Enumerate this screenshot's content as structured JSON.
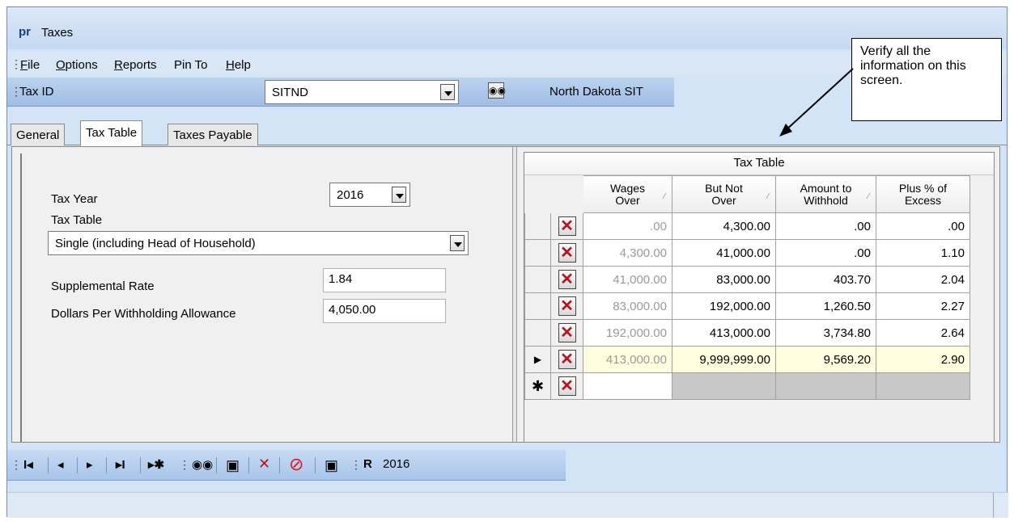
{
  "window": {
    "app_logo": "pr",
    "title": "Taxes"
  },
  "menu": [
    {
      "label": "File",
      "u": "F"
    },
    {
      "label": "Options",
      "u": "O"
    },
    {
      "label": "Reports",
      "u": "R"
    },
    {
      "label": "Pin To",
      "u": ""
    },
    {
      "label": "Help",
      "u": "H"
    }
  ],
  "taxbar": {
    "label": "Tax ID",
    "tax_id_value": "SITND",
    "tax_name": "North Dakota SIT"
  },
  "tabs": [
    "General",
    "Tax Table",
    "Taxes Payable"
  ],
  "active_tab": "Tax Table",
  "form": {
    "tax_year_label": "Tax Year",
    "tax_year_value": "2016",
    "tax_table_label": "Tax Table",
    "tax_table_value": "Single (including Head of Household)",
    "supplemental_label": "Supplemental Rate",
    "supplemental_value": "1.84",
    "allowance_label": "Dollars Per Withholding Allowance",
    "allowance_value": "4,050.00"
  },
  "grid": {
    "caption": "Tax Table",
    "headers": [
      [
        "Wages",
        "Over"
      ],
      [
        "But Not",
        "Over"
      ],
      [
        "Amount to",
        "Withhold"
      ],
      [
        "Plus % of",
        "Excess"
      ]
    ],
    "rows": [
      {
        "wages_over": ".00",
        "but_not_over": "4,300.00",
        "amount": ".00",
        "plus_pct": ".00"
      },
      {
        "wages_over": "4,300.00",
        "but_not_over": "41,000.00",
        "amount": ".00",
        "plus_pct": "1.10"
      },
      {
        "wages_over": "41,000.00",
        "but_not_over": "83,000.00",
        "amount": "403.70",
        "plus_pct": "2.04"
      },
      {
        "wages_over": "83,000.00",
        "but_not_over": "192,000.00",
        "amount": "1,260.50",
        "plus_pct": "2.27"
      },
      {
        "wages_over": "192,000.00",
        "but_not_over": "413,000.00",
        "amount": "3,734.80",
        "plus_pct": "2.64"
      },
      {
        "wages_over": "413,000.00",
        "but_not_over": "9,999,999.00",
        "amount": "9,569.20",
        "plus_pct": "2.90"
      }
    ],
    "current_row_index": 5
  },
  "toolbar": {
    "year": "2016"
  },
  "callout": {
    "text": "Verify all the information on this screen."
  },
  "icons": {
    "first": "first-record-icon",
    "prev": "previous-record-icon",
    "next": "next-record-icon",
    "last": "last-record-icon",
    "new": "new-record-icon",
    "find": "binoculars-icon",
    "save": "save-icon",
    "delete": "delete-icon",
    "cancel": "cancel-icon",
    "save_new": "save-and-new-icon",
    "report": "report-icon"
  }
}
